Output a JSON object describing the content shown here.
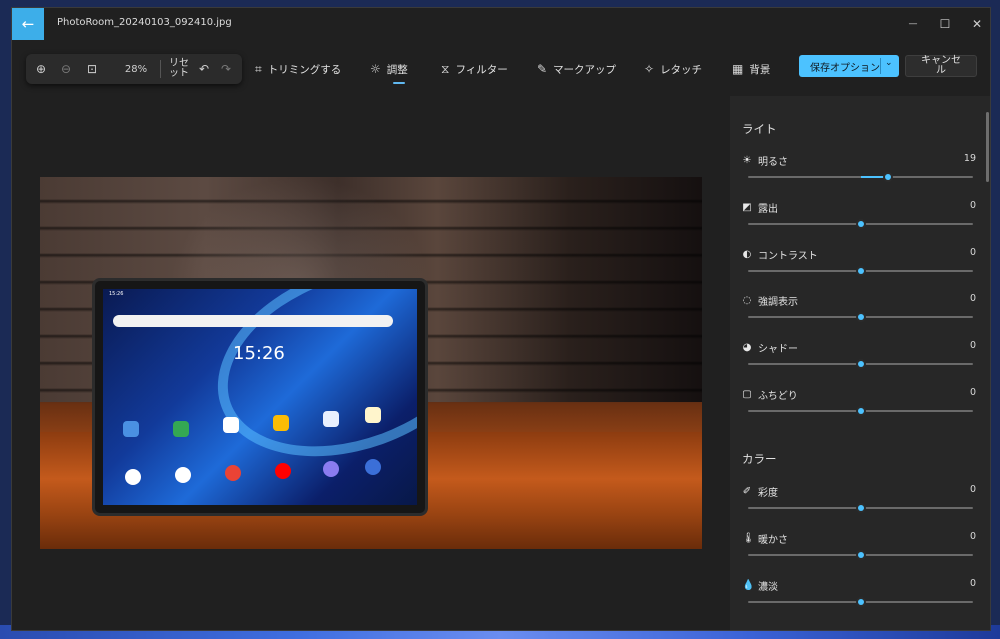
{
  "window": {
    "title": "PhotoRoom_20240103_092410.jpg",
    "back_icon": "←",
    "minimize_icon": "—",
    "maximize_icon": "☐",
    "close_icon": "✕"
  },
  "zoom": {
    "zoom_in_icon": "⊕",
    "zoom_out_icon": "⊖",
    "fit_icon": "⊡",
    "percent": "28%",
    "reset_label": "リセット",
    "undo_icon": "↶",
    "redo_icon": "↷"
  },
  "tools": [
    {
      "label": "トリミングする",
      "icon": "⌗"
    },
    {
      "label": "調整",
      "icon": "☼"
    },
    {
      "label": "フィルター",
      "icon": "⧖"
    },
    {
      "label": "マークアップ",
      "icon": "✎"
    },
    {
      "label": "レタッチ",
      "icon": "✧"
    },
    {
      "label": "背景",
      "icon": "▦"
    }
  ],
  "save": {
    "label": "保存オプション",
    "chevron": "⌄"
  },
  "cancel": {
    "label": "キャンセル"
  },
  "photo": {
    "tablet_time": "15:26",
    "tablet_status": "15:26"
  },
  "panel": {
    "light_title": "ライト",
    "light": [
      {
        "label": "明るさ",
        "icon": "☀",
        "value": "19",
        "level": 0.62
      },
      {
        "label": "露出",
        "icon": "◩",
        "value": "0",
        "level": 0.5
      },
      {
        "label": "コントラスト",
        "icon": "◐",
        "value": "0",
        "level": 0.5
      },
      {
        "label": "強調表示",
        "icon": "◌",
        "value": "0",
        "level": 0.5
      },
      {
        "label": "シャドー",
        "icon": "◕",
        "value": "0",
        "level": 0.5
      },
      {
        "label": "ふちどり",
        "icon": "▢",
        "value": "0",
        "level": 0.5
      }
    ],
    "color_title": "カラー",
    "color": [
      {
        "label": "彩度",
        "icon": "✐",
        "value": "0",
        "level": 0.5
      },
      {
        "label": "暖かさ",
        "icon": "🌡",
        "value": "0",
        "level": 0.5
      },
      {
        "label": "濃淡",
        "icon": "💧",
        "value": "0",
        "level": 0.5
      }
    ]
  },
  "colors": {
    "accent": "#4cc2ff",
    "panel_bg": "#272727",
    "window_bg": "#202020"
  }
}
